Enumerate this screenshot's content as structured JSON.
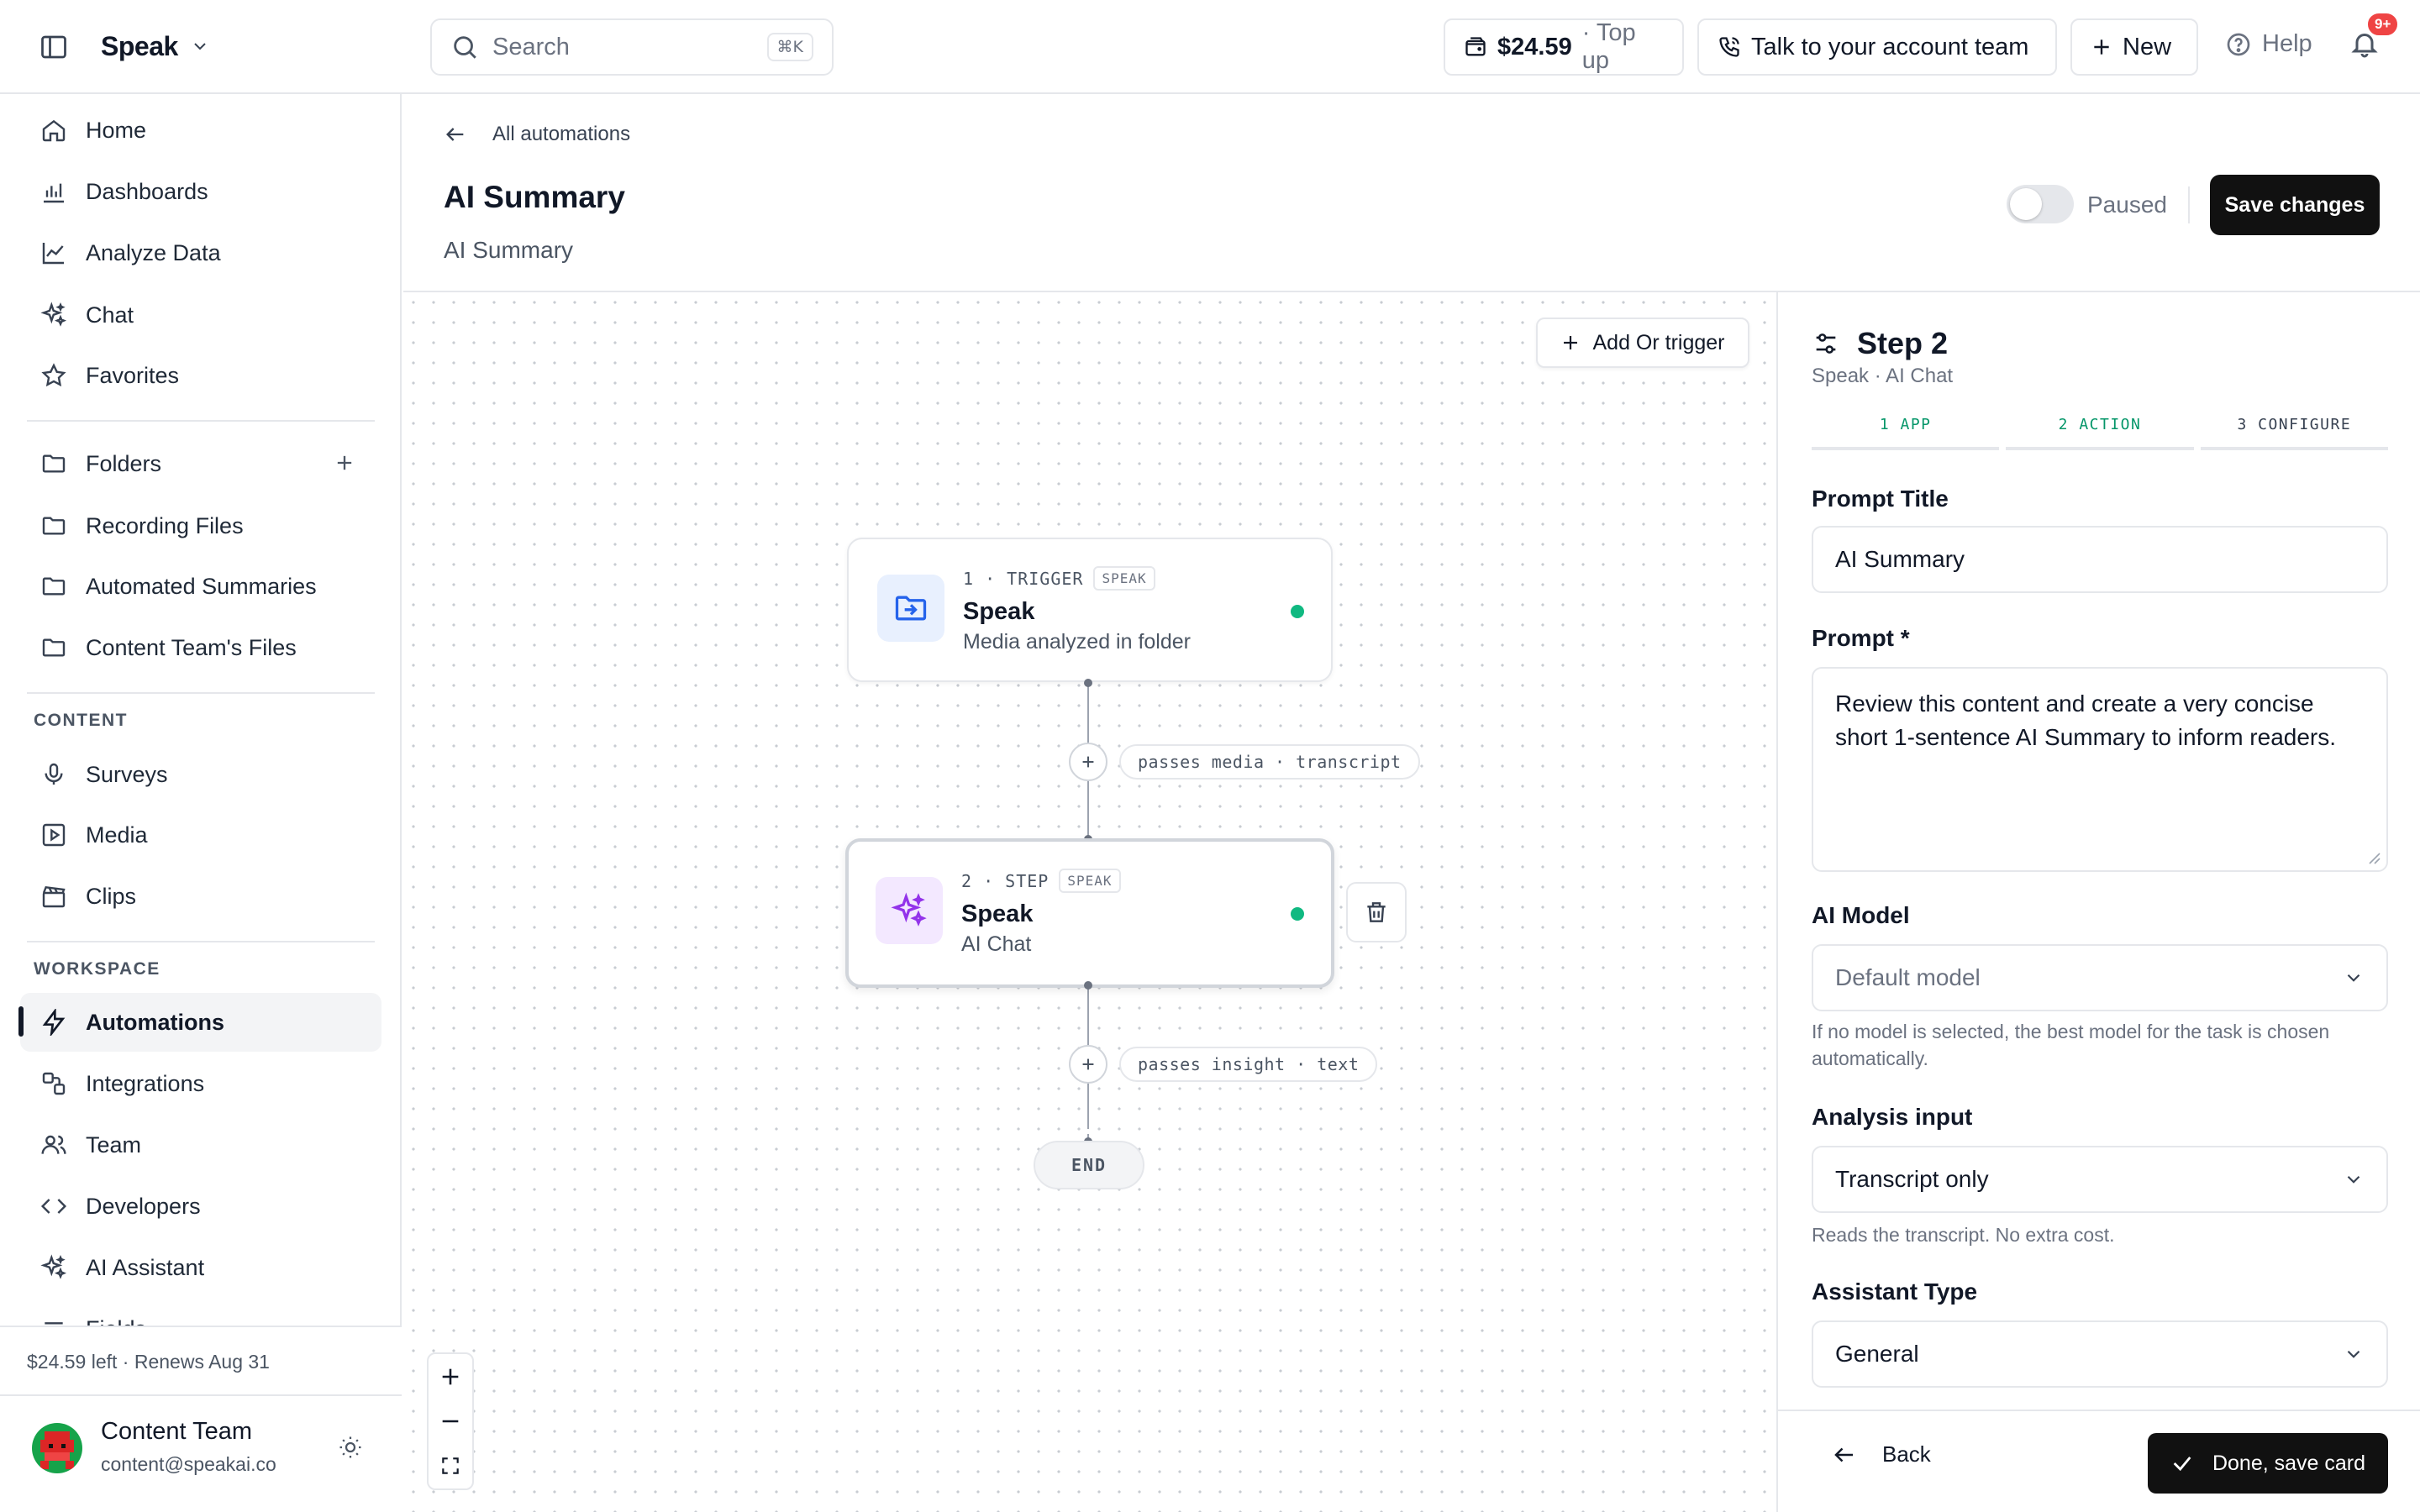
{
  "app": {
    "workspace_name": "Speak"
  },
  "search": {
    "placeholder": "Search",
    "shortcut": "⌘K"
  },
  "topbar": {
    "balance_amount": "$24.59",
    "balance_action": "· Top up",
    "account_team": "Talk to your account team",
    "new_label": "New",
    "help_label": "Help",
    "notifications_badge": "9+"
  },
  "sidebar": {
    "primary": [
      {
        "label": "Home",
        "icon": "home-icon"
      },
      {
        "label": "Dashboards",
        "icon": "bar-chart-icon"
      },
      {
        "label": "Analyze Data",
        "icon": "line-chart-icon"
      },
      {
        "label": "Chat",
        "icon": "sparkles-icon"
      },
      {
        "label": "Favorites",
        "icon": "star-icon"
      }
    ],
    "folders": [
      {
        "label": "Folders",
        "icon": "folder-icon"
      },
      {
        "label": "Recording Files",
        "icon": "folder-icon"
      },
      {
        "label": "Automated Summaries",
        "icon": "folder-icon"
      },
      {
        "label": "Content Team's Files",
        "icon": "folder-icon"
      }
    ],
    "content_label": "CONTENT",
    "content": [
      {
        "label": "Surveys",
        "icon": "microphone-icon"
      },
      {
        "label": "Media",
        "icon": "play-square-icon"
      },
      {
        "label": "Clips",
        "icon": "clapperboard-icon"
      }
    ],
    "workspace_label": "WORKSPACE",
    "workspace": [
      {
        "label": "Automations",
        "icon": "lightning-icon",
        "active": true
      },
      {
        "label": "Integrations",
        "icon": "integrations-icon"
      },
      {
        "label": "Team",
        "icon": "users-icon"
      },
      {
        "label": "Developers",
        "icon": "code-icon"
      },
      {
        "label": "AI Assistant",
        "icon": "sparkles-icon"
      },
      {
        "label": "Fields",
        "icon": "fields-icon"
      }
    ],
    "footer": {
      "credit": "$24.59 left · Renews Aug 31",
      "user_name": "Content Team",
      "user_email": "content@speakai.co"
    }
  },
  "page": {
    "back_label": "All automations",
    "title": "AI Summary",
    "subtitle": "AI Summary",
    "status_label": "Paused",
    "status_active": false,
    "save_label": "Save changes"
  },
  "canvas": {
    "add_trigger_label": "Add Or trigger",
    "nodes": [
      {
        "meta": "1 · TRIGGER",
        "chip": "SPEAK",
        "title": "Speak",
        "subtitle": "Media analyzed in folder",
        "icon": "folder-import-icon",
        "status_color": "#10b981"
      },
      {
        "meta": "2 · STEP",
        "chip": "SPEAK",
        "title": "Speak",
        "subtitle": "AI Chat",
        "icon": "sparkles-icon",
        "status_color": "#10b981"
      }
    ],
    "edges": [
      {
        "label": "passes media · transcript"
      },
      {
        "label": "passes insight · text"
      }
    ],
    "end_label": "END"
  },
  "panel": {
    "step_title": "Step 2",
    "step_subtitle": "Speak · AI Chat",
    "tabs": [
      {
        "label": "1 APP",
        "state": "done"
      },
      {
        "label": "2 ACTION",
        "state": "done"
      },
      {
        "label": "3 CONFIGURE",
        "state": "current"
      }
    ],
    "prompt_title_label": "Prompt Title",
    "prompt_title_value": "AI Summary",
    "prompt_label": "Prompt *",
    "prompt_value": "Review this content and create a very concise short 1-sentence AI Summary to inform readers.",
    "model_label": "AI Model",
    "model_value": "Default model",
    "model_help": "If no model is selected, the best model for the task is chosen automatically.",
    "analysis_label": "Analysis input",
    "analysis_value": "Transcript only",
    "analysis_help": "Reads the transcript. No extra cost.",
    "assistant_label": "Assistant Type",
    "assistant_value": "General",
    "back_label": "Back",
    "done_label": "Done, save card"
  }
}
